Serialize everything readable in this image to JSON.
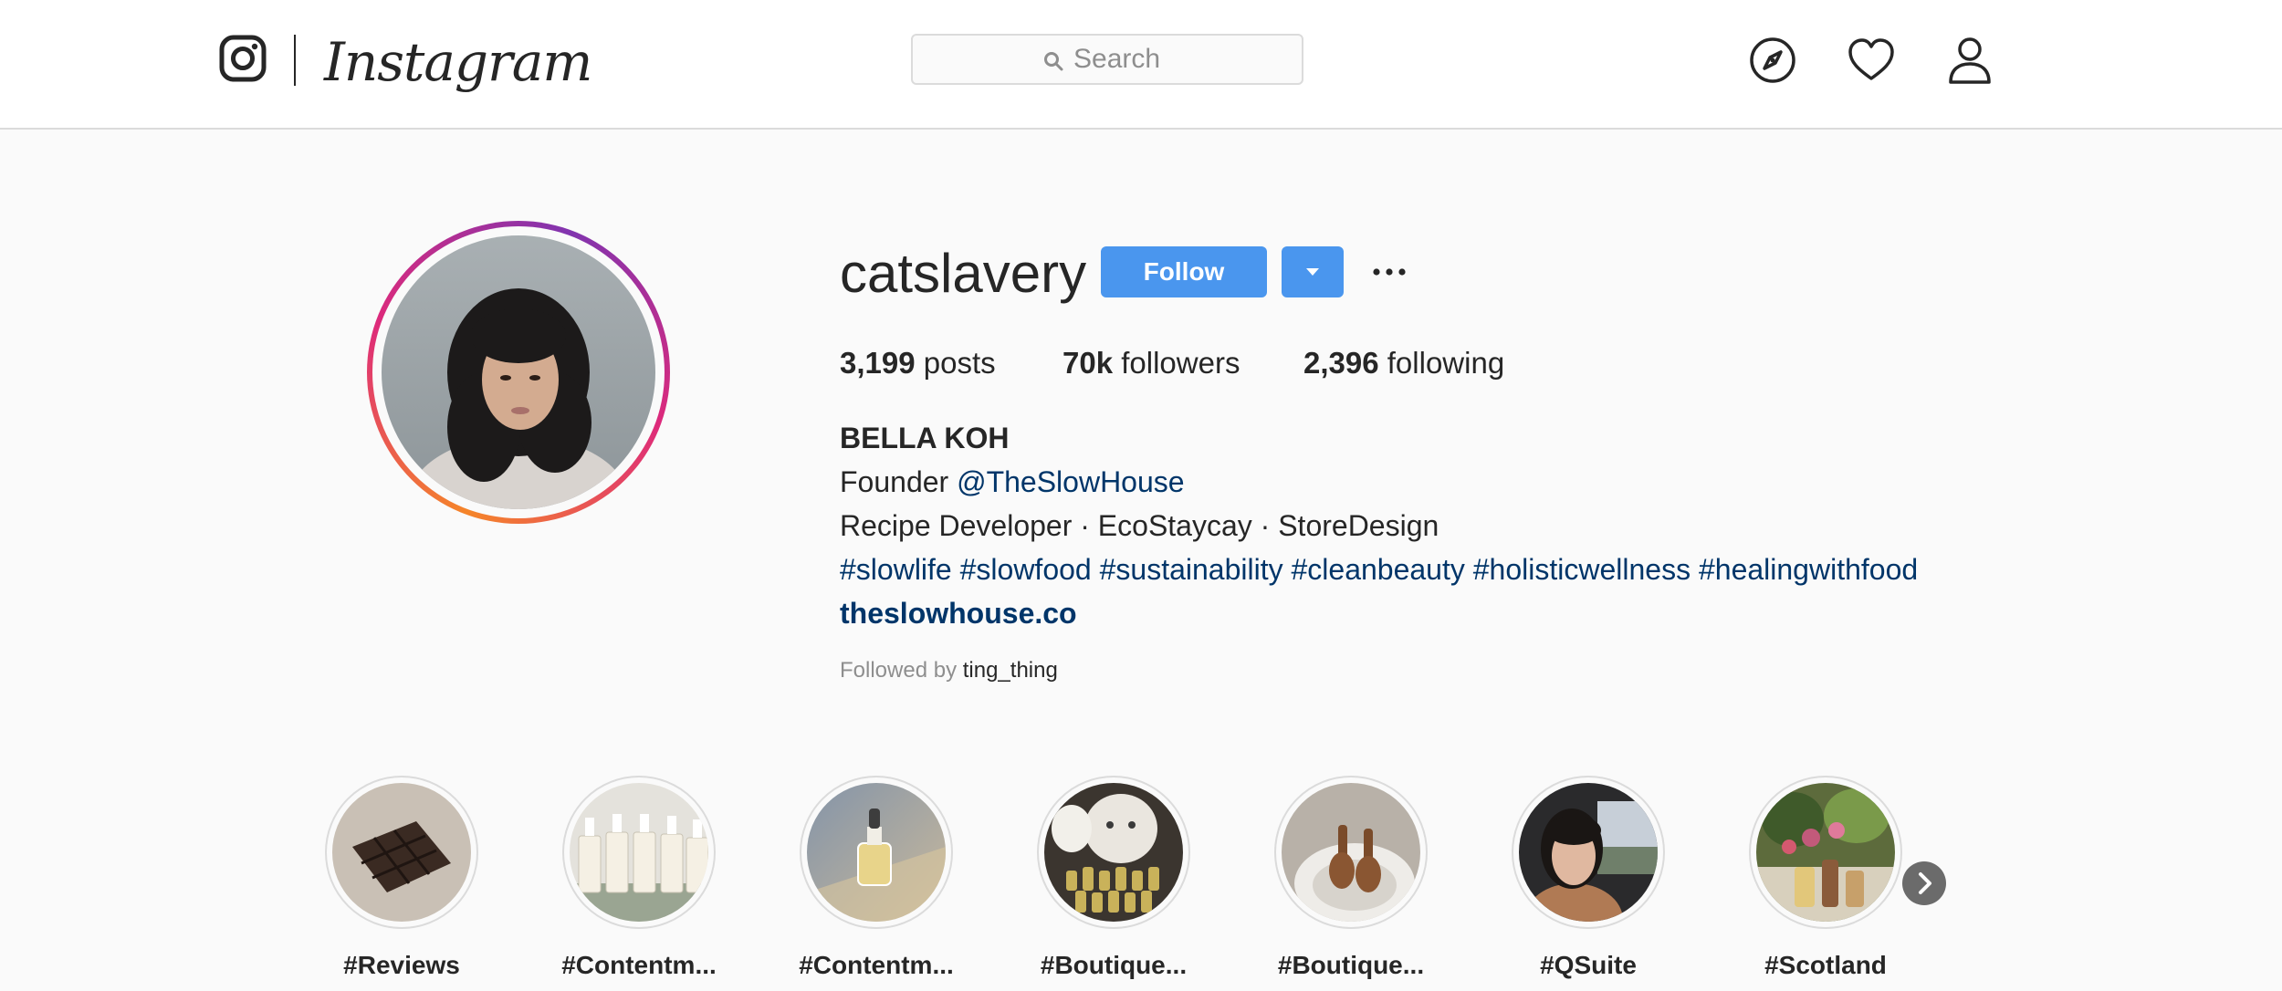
{
  "app": {
    "wordmark": "Instagram"
  },
  "search": {
    "placeholder": "Search"
  },
  "nav_icons": [
    "compass-icon",
    "heart-icon",
    "user-icon"
  ],
  "profile": {
    "username": "catslavery",
    "follow_label": "Follow",
    "stats": {
      "posts_count": "3,199",
      "posts_label": " posts",
      "followers_count": "70k",
      "followers_label": " followers",
      "following_count": "2,396",
      "following_label": " following"
    },
    "bio": {
      "full_name": "BELLA KOH",
      "founder_prefix": "Founder ",
      "founder_mention": "@TheSlowHouse",
      "tagline": "Recipe Developer · EcoStaycay · StoreDesign",
      "hashtags": "#slowlife #slowfood #sustainability #cleanbeauty #holisticwellness #healingwithfood",
      "website": "theslowhouse.co"
    },
    "followed_by_prefix": "Followed by ",
    "followed_by_user": "ting_thing"
  },
  "highlights": [
    {
      "label": "#Reviews"
    },
    {
      "label": "#Contentm..."
    },
    {
      "label": "#Contentm..."
    },
    {
      "label": "#Boutique..."
    },
    {
      "label": "#Boutique..."
    },
    {
      "label": "#QSuite"
    },
    {
      "label": "#Scotland"
    }
  ],
  "colors": {
    "accent": "#4a96ee",
    "link": "#003569",
    "text": "#262626",
    "muted": "#8e8e8e",
    "border": "#dbdbdb",
    "background": "#fafafa"
  }
}
